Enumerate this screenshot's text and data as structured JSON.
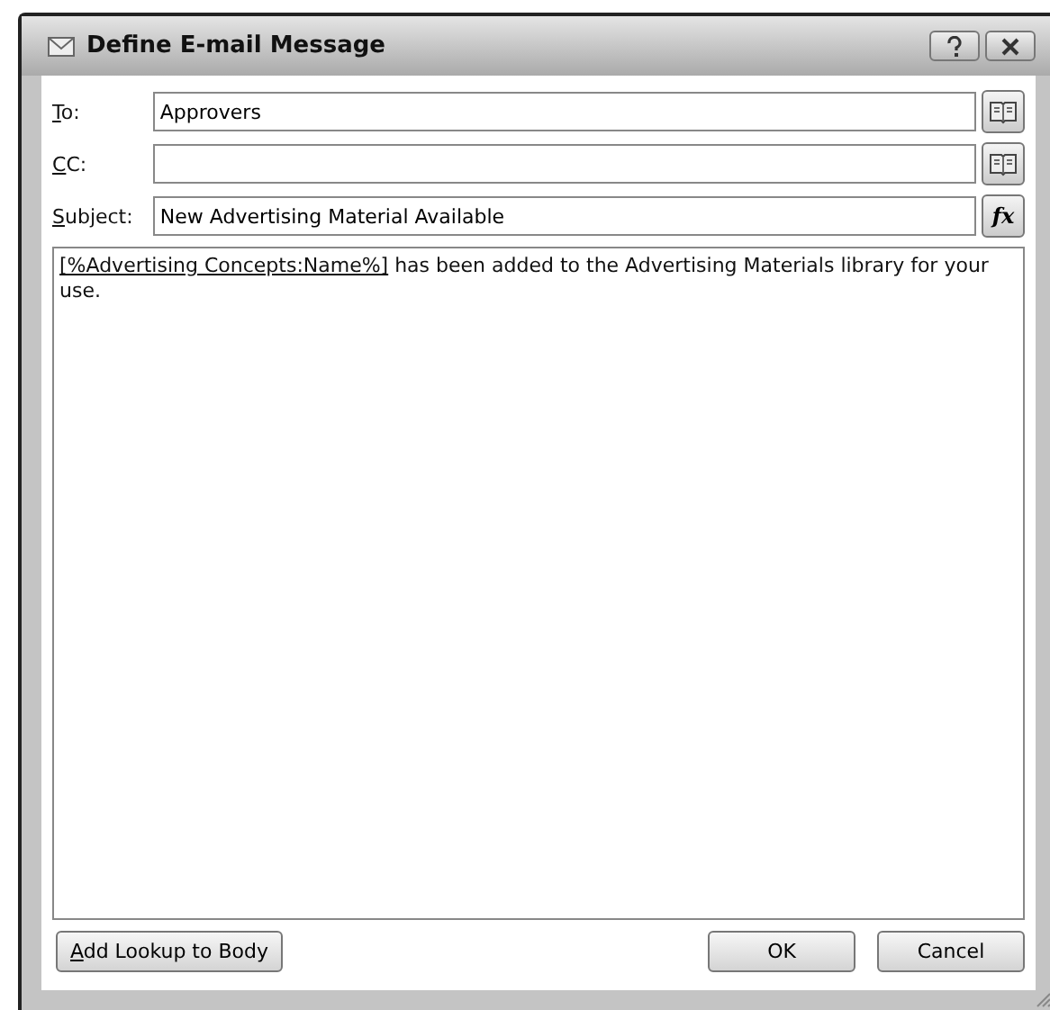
{
  "window": {
    "title": "Define E-mail Message"
  },
  "fields": [
    {
      "key": "T",
      "rest": "o:",
      "value": "Approvers",
      "button": {
        "kind": "book"
      }
    },
    {
      "key": "C",
      "rest": "C:",
      "button": {
        "kind": "book"
      }
    },
    {
      "key": "S",
      "rest": "ubject:",
      "value": "New Advertising Material Available",
      "button": {
        "kind": "formula",
        "label": "fx"
      }
    }
  ],
  "body": {
    "link": "[%Advertising Concepts:Name%]",
    "text": " has been added to the Advertising Materials library for your use."
  },
  "buttons": [
    {
      "key": "A",
      "rest": "dd Lookup to Body",
      "kind": "left"
    },
    {
      "rest": "OK",
      "kind": "right"
    },
    {
      "rest": "Cancel",
      "kind": "right"
    }
  ]
}
